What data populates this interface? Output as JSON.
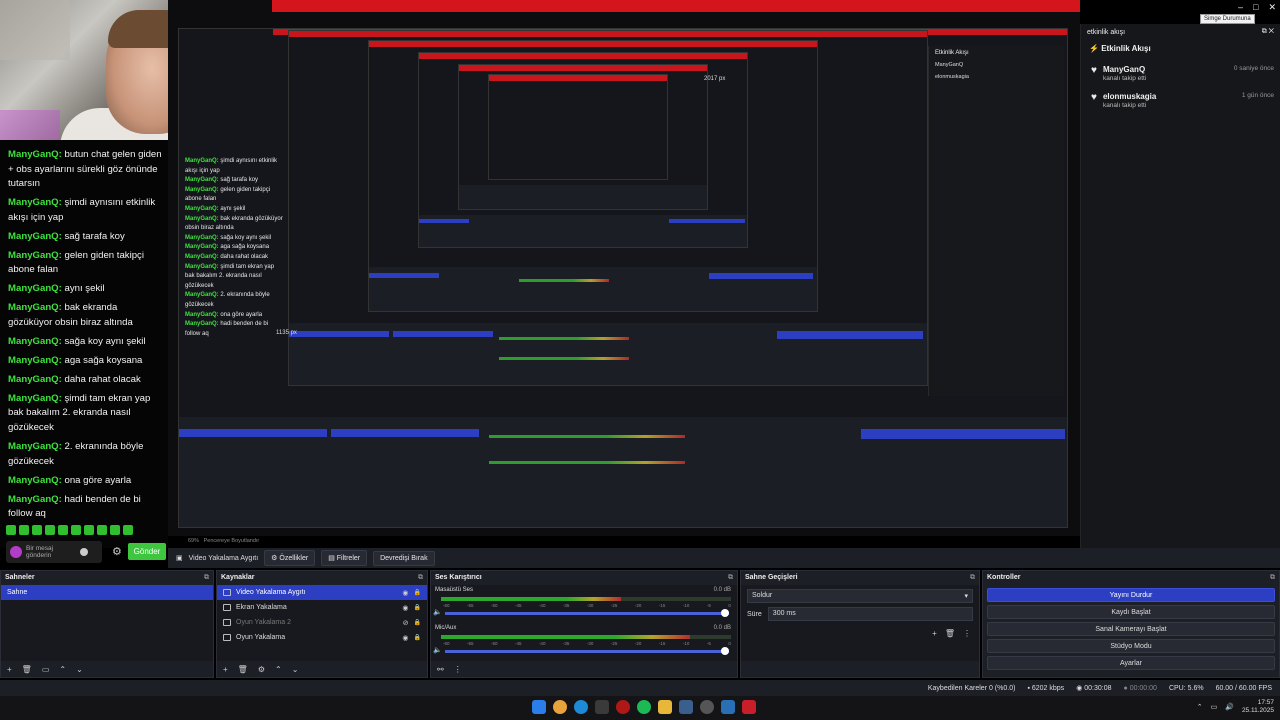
{
  "chat": {
    "messages": [
      {
        "user": "ManyGanQ:",
        "text": " butun chat gelen giden + obs ayarlarını sürekli göz önünde tutarsın"
      },
      {
        "user": "ManyGanQ:",
        "text": " şimdi aynısını etkinlik akışı için yap"
      },
      {
        "user": "ManyGanQ:",
        "text": " sağ tarafa koy"
      },
      {
        "user": "ManyGanQ:",
        "text": " gelen giden takipçi abone falan"
      },
      {
        "user": "ManyGanQ:",
        "text": " aynı şekil"
      },
      {
        "user": "ManyGanQ:",
        "text": " bak ekranda gözüküyor obsin biraz altında"
      },
      {
        "user": "ManyGanQ:",
        "text": " sağa koy aynı şekil"
      },
      {
        "user": "ManyGanQ:",
        "text": " aga sağa koysana"
      },
      {
        "user": "ManyGanQ:",
        "text": " daha rahat olacak"
      },
      {
        "user": "ManyGanQ:",
        "text": " şimdi tam ekran yap bak bakalım 2. ekranda nasıl gözükecek"
      },
      {
        "user": "ManyGanQ:",
        "text": " 2. ekranında böyle gözükecek"
      },
      {
        "user": "ManyGanQ:",
        "text": " ona göre ayarla"
      },
      {
        "user": "ManyGanQ:",
        "text": " hadi benden de bi follow aq"
      }
    ],
    "input_placeholder": "Bir mesaj gönderin",
    "send_label": "Gönder"
  },
  "preview": {
    "px_label_top": "2017 px",
    "px_label_mid": "1135 px"
  },
  "activity": {
    "dock_title": "etkinlik akışı",
    "title": "Etkinlik Akışı",
    "tooltip": "Simge Durumuna",
    "items": [
      {
        "name": "ManyGanQ",
        "desc": "kanalı takip etti",
        "time": "0 saniye önce"
      },
      {
        "name": "elonmuskagia",
        "desc": "kanalı takip etti",
        "time": "1 gün önce"
      }
    ]
  },
  "toolbar": {
    "source_name": "Video Yakalama Aygıtı",
    "properties": "Özellikler",
    "filters": "Filtreler",
    "deactivate": "Devredişi Bırak",
    "zoom": "69%",
    "zoom_label": "Pencereye Boyutlandır"
  },
  "scenes": {
    "title": "Sahneler",
    "items": [
      "Sahne"
    ]
  },
  "sources": {
    "title": "Kaynaklar",
    "items": [
      {
        "label": "Video Yakalama Aygıtı",
        "selected": true,
        "hidden": false
      },
      {
        "label": "Ekran Yakalama",
        "selected": false,
        "hidden": false
      },
      {
        "label": "Oyun Yakalama 2",
        "selected": false,
        "hidden": true
      },
      {
        "label": "Oyun Yakalama",
        "selected": false,
        "hidden": false
      }
    ]
  },
  "mixer": {
    "title": "Ses Karıştırıcı",
    "channels": [
      {
        "name": "Masaüstü Ses",
        "db": "0.0 dB",
        "level": 0.62
      },
      {
        "name": "Mic/Aux",
        "db": "0.0 dB",
        "level": 0.86
      }
    ],
    "scale": [
      "-60",
      "-55",
      "-50",
      "-45",
      "-40",
      "-35",
      "-30",
      "-25",
      "-20",
      "-15",
      "-10",
      "-5",
      "0"
    ]
  },
  "transitions": {
    "title": "Sahne Geçişleri",
    "selected": "Soldur",
    "duration_label": "Süre",
    "duration_value": "300 ms"
  },
  "controls": {
    "title": "Kontroller",
    "buttons": [
      "Yayını Durdur",
      "Kaydı Başlat",
      "Sanal Kamerayı Başlat",
      "Stüdyo Modu",
      "Ayarlar"
    ]
  },
  "status": {
    "dropped": "Kaybedilen Kareler 0 (%0.0)",
    "bitrate": "6202 kbps",
    "live_time": "00:30:08",
    "rec_time": "00:00:00",
    "cpu": "CPU: 5.6%",
    "fps": "60.00 / 60.00 FPS"
  },
  "taskbar": {
    "time": "17:57",
    "date": "25.11.2025"
  },
  "colors": {
    "accent_blue": "#2c3fc2",
    "chat_user": "#3fe13f",
    "obs_red": "#d4151b",
    "send_green": "#3ec73e"
  }
}
